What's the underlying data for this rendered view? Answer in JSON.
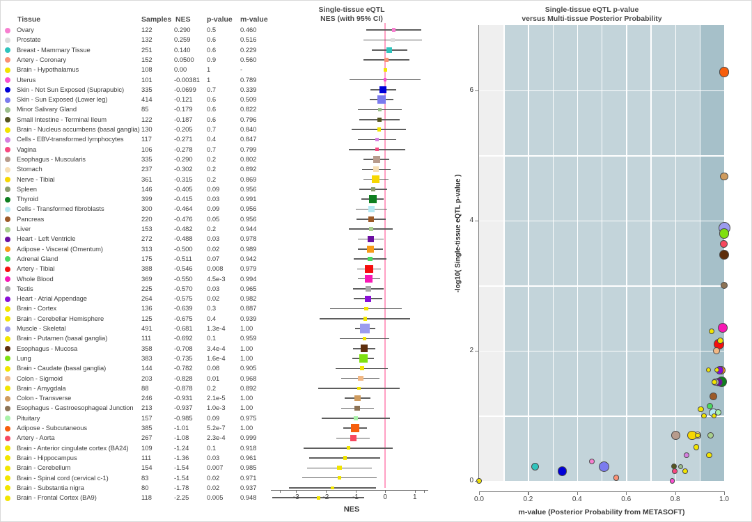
{
  "table": {
    "columns": [
      "Tissue",
      "Samples",
      "NES",
      "p-value",
      "m-value"
    ],
    "rows": [
      {
        "tissue": "Ovary",
        "color": "#f77fd0",
        "samples": "122",
        "nes": "0.290",
        "pvalue": "0.5",
        "mvalue": "0.460",
        "nes_v": 0.29,
        "n": 122,
        "ci": [
          -0.63,
          1.21
        ],
        "mv": 0.46,
        "logp": 0.3
      },
      {
        "tissue": "Prostate",
        "color": "#dcdcdc",
        "samples": "132",
        "nes": "0.259",
        "pvalue": "0.6",
        "mvalue": "0.516",
        "nes_v": 0.259,
        "n": 132,
        "ci": [
          -0.72,
          1.24
        ],
        "mv": 0.516,
        "logp": 0.22
      },
      {
        "tissue": "Breast - Mammary Tissue",
        "color": "#2fc4bd",
        "samples": "251",
        "nes": "0.140",
        "pvalue": "0.6",
        "mvalue": "0.229",
        "nes_v": 0.14,
        "n": 251,
        "ci": [
          -0.46,
          0.74
        ],
        "mv": 0.229,
        "logp": 0.22
      },
      {
        "tissue": "Artery - Coronary",
        "color": "#fa9175",
        "samples": "152",
        "nes": "0.0500",
        "pvalue": "0.9",
        "mvalue": "0.560",
        "nes_v": 0.05,
        "n": 152,
        "ci": [
          -0.72,
          0.82
        ],
        "mv": 0.56,
        "logp": 0.05
      },
      {
        "tissue": "Brain - Hypothalamus",
        "color": "#f2e500",
        "samples": "108",
        "nes": "0.00",
        "pvalue": "1",
        "mvalue": "-",
        "nes_v": 0.0,
        "n": 108,
        "ci": [
          0.0,
          0.0
        ],
        "mv": 0.0,
        "logp": 0.0
      },
      {
        "tissue": "Uterus",
        "color": "#fa4fd0",
        "samples": "101",
        "nes": "-0.00381",
        "pvalue": "1",
        "mvalue": "0.789",
        "nes_v": -0.00381,
        "n": 101,
        "ci": [
          -1.21,
          1.2
        ],
        "mv": 0.789,
        "logp": 0.0
      },
      {
        "tissue": "Skin - Not Sun Exposed (Suprapubic)",
        "color": "#0000d7",
        "samples": "335",
        "nes": "-0.0699",
        "pvalue": "0.7",
        "mvalue": "0.339",
        "nes_v": -0.0699,
        "n": 335,
        "ci": [
          -0.5,
          0.36
        ],
        "mv": 0.339,
        "logp": 0.15
      },
      {
        "tissue": "Skin - Sun Exposed (Lower leg)",
        "color": "#7b7bee",
        "samples": "414",
        "nes": "-0.121",
        "pvalue": "0.6",
        "mvalue": "0.509",
        "nes_v": -0.121,
        "n": 414,
        "ci": [
          -0.52,
          0.28
        ],
        "mv": 0.509,
        "logp": 0.22
      },
      {
        "tissue": "Minor Salivary Gland",
        "color": "#9cbf8c",
        "samples": "85",
        "nes": "-0.179",
        "pvalue": "0.6",
        "mvalue": "0.822",
        "nes_v": -0.179,
        "n": 85,
        "ci": [
          -0.92,
          0.56
        ],
        "mv": 0.822,
        "logp": 0.22
      },
      {
        "tissue": "Small Intestine - Terminal Ileum",
        "color": "#55551f",
        "samples": "122",
        "nes": "-0.187",
        "pvalue": "0.6",
        "mvalue": "0.796",
        "nes_v": -0.187,
        "n": 122,
        "ci": [
          -0.87,
          0.5
        ],
        "mv": 0.796,
        "logp": 0.22
      },
      {
        "tissue": "Brain - Nucleus accumbens (basal ganglia)",
        "color": "#f2e500",
        "samples": "130",
        "nes": "-0.205",
        "pvalue": "0.7",
        "mvalue": "0.840",
        "nes_v": -0.205,
        "n": 130,
        "ci": [
          -1.12,
          0.71
        ],
        "mv": 0.84,
        "logp": 0.15
      },
      {
        "tissue": "Cells - EBV-transformed lymphocytes",
        "color": "#d67fe0",
        "samples": "117",
        "nes": "-0.271",
        "pvalue": "0.4",
        "mvalue": "0.847",
        "nes_v": -0.271,
        "n": 117,
        "ci": [
          -0.91,
          0.37
        ],
        "mv": 0.847,
        "logp": 0.4
      },
      {
        "tissue": "Vagina",
        "color": "#f7487f",
        "samples": "106",
        "nes": "-0.278",
        "pvalue": "0.7",
        "mvalue": "0.799",
        "nes_v": -0.278,
        "n": 106,
        "ci": [
          -1.22,
          0.67
        ],
        "mv": 0.799,
        "logp": 0.15
      },
      {
        "tissue": "Esophagus - Muscularis",
        "color": "#b79b8c",
        "samples": "335",
        "nes": "-0.290",
        "pvalue": "0.2",
        "mvalue": "0.802",
        "nes_v": -0.29,
        "n": 335,
        "ci": [
          -0.72,
          0.14
        ],
        "mv": 0.802,
        "logp": 0.7
      },
      {
        "tissue": "Stomach",
        "color": "#f7dfb4",
        "samples": "237",
        "nes": "-0.302",
        "pvalue": "0.2",
        "mvalue": "0.892",
        "nes_v": -0.302,
        "n": 237,
        "ci": [
          -0.78,
          0.18
        ],
        "mv": 0.892,
        "logp": 0.7
      },
      {
        "tissue": "Nerve - Tibial",
        "color": "#f7d700",
        "samples": "361",
        "nes": "-0.315",
        "pvalue": "0.2",
        "mvalue": "0.869",
        "nes_v": -0.315,
        "n": 361,
        "ci": [
          -0.74,
          0.11
        ],
        "mv": 0.869,
        "logp": 0.7
      },
      {
        "tissue": "Spleen",
        "color": "#8a9c6e",
        "samples": "146",
        "nes": "-0.405",
        "pvalue": "0.09",
        "mvalue": "0.956",
        "nes_v": -0.405,
        "n": 146,
        "ci": [
          -0.88,
          0.07
        ],
        "mv": 0.956,
        "logp": 1.05
      },
      {
        "tissue": "Thyroid",
        "color": "#0f7f20",
        "samples": "399",
        "nes": "-0.415",
        "pvalue": "0.03",
        "mvalue": "0.991",
        "nes_v": -0.415,
        "n": 399,
        "ci": [
          -0.79,
          -0.04
        ],
        "mv": 0.991,
        "logp": 1.52
      },
      {
        "tissue": "Cells - Transformed fibroblasts",
        "color": "#b4e8f2",
        "samples": "300",
        "nes": "-0.464",
        "pvalue": "0.09",
        "mvalue": "0.956",
        "nes_v": -0.464,
        "n": 300,
        "ci": [
          -1.0,
          0.07
        ],
        "mv": 0.956,
        "logp": 1.05
      },
      {
        "tissue": "Pancreas",
        "color": "#9c5a28",
        "samples": "220",
        "nes": "-0.476",
        "pvalue": "0.05",
        "mvalue": "0.956",
        "nes_v": -0.476,
        "n": 220,
        "ci": [
          -0.96,
          0.01
        ],
        "mv": 0.956,
        "logp": 1.3
      },
      {
        "tissue": "Liver",
        "color": "#a8cf8c",
        "samples": "153",
        "nes": "-0.482",
        "pvalue": "0.2",
        "mvalue": "0.944",
        "nes_v": -0.482,
        "n": 153,
        "ci": [
          -1.22,
          0.26
        ],
        "mv": 0.944,
        "logp": 0.7
      },
      {
        "tissue": "Heart - Left Ventricle",
        "color": "#6b0fa0",
        "samples": "272",
        "nes": "-0.488",
        "pvalue": "0.03",
        "mvalue": "0.978",
        "nes_v": -0.488,
        "n": 272,
        "ci": [
          -0.92,
          -0.05
        ],
        "mv": 0.978,
        "logp": 1.52
      },
      {
        "tissue": "Adipose - Visceral (Omentum)",
        "color": "#f79b18",
        "samples": "313",
        "nes": "-0.500",
        "pvalue": "0.02",
        "mvalue": "0.989",
        "nes_v": -0.5,
        "n": 313,
        "ci": [
          -0.92,
          -0.08
        ],
        "mv": 0.989,
        "logp": 1.7
      },
      {
        "tissue": "Adrenal Gland",
        "color": "#49d95e",
        "samples": "175",
        "nes": "-0.511",
        "pvalue": "0.07",
        "mvalue": "0.942",
        "nes_v": -0.511,
        "n": 175,
        "ci": [
          -1.06,
          0.04
        ],
        "mv": 0.942,
        "logp": 1.15
      },
      {
        "tissue": "Artery - Tibial",
        "color": "#f50f0f",
        "samples": "388",
        "nes": "-0.546",
        "pvalue": "0.008",
        "mvalue": "0.979",
        "nes_v": -0.546,
        "n": 388,
        "ci": [
          -0.95,
          -0.14
        ],
        "mv": 0.979,
        "logp": 2.1
      },
      {
        "tissue": "Whole Blood",
        "color": "#f718b4",
        "samples": "369",
        "nes": "-0.550",
        "pvalue": "4.5e-3",
        "mvalue": "0.994",
        "nes_v": -0.55,
        "n": 369,
        "ci": [
          -0.93,
          -0.17
        ],
        "mv": 0.994,
        "logp": 2.35
      },
      {
        "tissue": "Testis",
        "color": "#a8a8a8",
        "samples": "225",
        "nes": "-0.570",
        "pvalue": "0.03",
        "mvalue": "0.965",
        "nes_v": -0.57,
        "n": 225,
        "ci": [
          -1.08,
          -0.06
        ],
        "mv": 0.965,
        "logp": 1.52
      },
      {
        "tissue": "Heart - Atrial Appendage",
        "color": "#8a0fd7",
        "samples": "264",
        "nes": "-0.575",
        "pvalue": "0.02",
        "mvalue": "0.982",
        "nes_v": -0.575,
        "n": 264,
        "ci": [
          -1.05,
          -0.1
        ],
        "mv": 0.982,
        "logp": 1.7
      },
      {
        "tissue": "Brain - Cortex",
        "color": "#f2e500",
        "samples": "136",
        "nes": "-0.639",
        "pvalue": "0.3",
        "mvalue": "0.887",
        "nes_v": -0.639,
        "n": 136,
        "ci": [
          -1.85,
          0.57
        ],
        "mv": 0.887,
        "logp": 0.52
      },
      {
        "tissue": "Brain - Cerebellar Hemisphere",
        "color": "#f2e500",
        "samples": "125",
        "nes": "-0.675",
        "pvalue": "0.4",
        "mvalue": "0.939",
        "nes_v": -0.675,
        "n": 125,
        "ci": [
          -2.2,
          0.85
        ],
        "mv": 0.939,
        "logp": 0.4
      },
      {
        "tissue": "Muscle - Skeletal",
        "color": "#9b9bee",
        "samples": "491",
        "nes": "-0.681",
        "pvalue": "1.3e-4",
        "mvalue": "1.00",
        "nes_v": -0.681,
        "n": 491,
        "ci": [
          -1.02,
          -0.34
        ],
        "mv": 1.0,
        "logp": 3.89
      },
      {
        "tissue": "Brain - Putamen (basal ganglia)",
        "color": "#f2e500",
        "samples": "111",
        "nes": "-0.692",
        "pvalue": "0.1",
        "mvalue": "0.959",
        "nes_v": -0.692,
        "n": 111,
        "ci": [
          -1.52,
          0.14
        ],
        "mv": 0.959,
        "logp": 1.0
      },
      {
        "tissue": "Esophagus - Mucosa",
        "color": "#5e2e0c",
        "samples": "358",
        "nes": "-0.708",
        "pvalue": "3.4e-4",
        "mvalue": "1.00",
        "nes_v": -0.708,
        "n": 358,
        "ci": [
          -1.09,
          -0.33
        ],
        "mv": 1.0,
        "logp": 3.47
      },
      {
        "tissue": "Lung",
        "color": "#7fe00f",
        "samples": "383",
        "nes": "-0.735",
        "pvalue": "1.6e-4",
        "mvalue": "1.00",
        "nes_v": -0.735,
        "n": 383,
        "ci": [
          -1.1,
          -0.37
        ],
        "mv": 1.0,
        "logp": 3.8
      },
      {
        "tissue": "Brain - Caudate (basal ganglia)",
        "color": "#f2e500",
        "samples": "144",
        "nes": "-0.782",
        "pvalue": "0.08",
        "mvalue": "0.905",
        "nes_v": -0.782,
        "n": 144,
        "ci": [
          -1.66,
          0.1
        ],
        "mv": 0.905,
        "logp": 1.1
      },
      {
        "tissue": "Colon - Sigmoid",
        "color": "#f2b884",
        "samples": "203",
        "nes": "-0.828",
        "pvalue": "0.01",
        "mvalue": "0.968",
        "nes_v": -0.828,
        "n": 203,
        "ci": [
          -1.47,
          -0.19
        ],
        "mv": 0.968,
        "logp": 2.0
      },
      {
        "tissue": "Brain - Amygdala",
        "color": "#f2e500",
        "samples": "88",
        "nes": "-0.878",
        "pvalue": "0.2",
        "mvalue": "0.892",
        "nes_v": -0.878,
        "n": 88,
        "ci": [
          -2.25,
          0.49
        ],
        "mv": 0.892,
        "logp": 0.7
      },
      {
        "tissue": "Colon - Transverse",
        "color": "#cf9b5e",
        "samples": "246",
        "nes": "-0.931",
        "pvalue": "2.1e-5",
        "mvalue": "1.00",
        "nes_v": -0.931,
        "n": 246,
        "ci": [
          -1.36,
          -0.5
        ],
        "mv": 1.0,
        "logp": 4.68
      },
      {
        "tissue": "Esophagus - Gastroesophageal Junction",
        "color": "#8c7254",
        "samples": "213",
        "nes": "-0.937",
        "pvalue": "1.0e-3",
        "mvalue": "1.00",
        "nes_v": -0.937,
        "n": 213,
        "ci": [
          -1.48,
          -0.39
        ],
        "mv": 1.0,
        "logp": 3.0
      },
      {
        "tissue": "Pituitary",
        "color": "#aaf2aa",
        "samples": "157",
        "nes": "-0.985",
        "pvalue": "0.09",
        "mvalue": "0.975",
        "nes_v": -0.985,
        "n": 157,
        "ci": [
          -2.13,
          0.16
        ],
        "mv": 0.975,
        "logp": 1.05
      },
      {
        "tissue": "Adipose - Subcutaneous",
        "color": "#f75e0c",
        "samples": "385",
        "nes": "-1.01",
        "pvalue": "5.2e-7",
        "mvalue": "1.00",
        "nes_v": -1.01,
        "n": 385,
        "ci": [
          -1.4,
          -0.62
        ],
        "mv": 1.0,
        "logp": 6.28
      },
      {
        "tissue": "Artery - Aorta",
        "color": "#f7485e",
        "samples": "267",
        "nes": "-1.08",
        "pvalue": "2.3e-4",
        "mvalue": "0.999",
        "nes_v": -1.08,
        "n": 267,
        "ci": [
          -1.64,
          -0.52
        ],
        "mv": 0.999,
        "logp": 3.64
      },
      {
        "tissue": "Brain - Anterior cingulate cortex (BA24)",
        "color": "#f2e500",
        "samples": "109",
        "nes": "-1.24",
        "pvalue": "0.1",
        "mvalue": "0.918",
        "nes_v": -1.24,
        "n": 109,
        "ci": [
          -2.74,
          0.26
        ],
        "mv": 0.918,
        "logp": 1.0
      },
      {
        "tissue": "Brain - Hippocampus",
        "color": "#f2e500",
        "samples": "111",
        "nes": "-1.36",
        "pvalue": "0.03",
        "mvalue": "0.961",
        "nes_v": -1.36,
        "n": 111,
        "ci": [
          -2.56,
          -0.16
        ],
        "mv": 0.961,
        "logp": 1.52
      },
      {
        "tissue": "Brain - Cerebellum",
        "color": "#f2e500",
        "samples": "154",
        "nes": "-1.54",
        "pvalue": "0.007",
        "mvalue": "0.985",
        "nes_v": -1.54,
        "n": 154,
        "ci": [
          -2.63,
          -0.45
        ],
        "mv": 0.985,
        "logp": 2.15
      },
      {
        "tissue": "Brain - Spinal cord (cervical c-1)",
        "color": "#f2e500",
        "samples": "83",
        "nes": "-1.54",
        "pvalue": "0.02",
        "mvalue": "0.971",
        "nes_v": -1.54,
        "n": 83,
        "ci": [
          -2.8,
          -0.28
        ],
        "mv": 0.971,
        "logp": 1.7
      },
      {
        "tissue": "Brain - Substantia nigra",
        "color": "#f2e500",
        "samples": "80",
        "nes": "-1.78",
        "pvalue": "0.02",
        "mvalue": "0.937",
        "nes_v": -1.78,
        "n": 80,
        "ci": [
          -3.24,
          -0.32
        ],
        "mv": 0.937,
        "logp": 1.7
      },
      {
        "tissue": "Brain - Frontal Cortex (BA9)",
        "color": "#f2e500",
        "samples": "118",
        "nes": "-2.25",
        "pvalue": "0.005",
        "mvalue": "0.948",
        "nes_v": -2.25,
        "n": 118,
        "ci": [
          -3.8,
          -0.7
        ],
        "mv": 0.948,
        "logp": 2.3
      }
    ]
  },
  "forest": {
    "title_line1": "Single-tissue eQTL",
    "title_line2": "NES (with 95% CI)",
    "xlabel": "NES",
    "xticks": [
      "-3",
      "-2",
      "-1",
      "0",
      "1"
    ],
    "xtick_values": [
      -3,
      -2,
      -1,
      0,
      1
    ],
    "xlim": [
      -3.85,
      1.45
    ],
    "zero_line_color": "#ff9fc4"
  },
  "scatter": {
    "title_line1": "Single-tissue eQTL p-value",
    "title_line2": "versus Multi-tissue Posterior Probability",
    "xlabel": "m-value (Posterior Probability from METASOFT)",
    "ylabel": "-log10( Single-tissue eQTL p-value )",
    "xticks": [
      "0.0",
      "0.2",
      "0.4",
      "0.6",
      "0.8",
      "1.0"
    ],
    "xtick_values": [
      0.0,
      0.2,
      0.4,
      0.6,
      0.8,
      1.0
    ],
    "yticks": [
      "0",
      "2",
      "4",
      "6"
    ],
    "ytick_values": [
      0,
      2,
      4,
      6
    ],
    "xlim": [
      0.0,
      1.0
    ],
    "ylim": [
      0.0,
      7.0
    ],
    "band_light_color": "#efefef",
    "band_mid_color": "#c3d4da",
    "band_dark_color": "#a6c0c9",
    "grid_color": "#ffffff"
  },
  "chart_data": {
    "type": "scatter",
    "title": "Single-tissue eQTL p-value versus Multi-tissue Posterior Probability",
    "xlabel": "m-value (Posterior Probability from METASOFT)",
    "ylabel": "-log10( Single-tissue eQTL p-value )",
    "xlim": [
      0.0,
      1.0
    ],
    "ylim": [
      0.0,
      7.0
    ],
    "grid": true,
    "legend": "none"
  }
}
